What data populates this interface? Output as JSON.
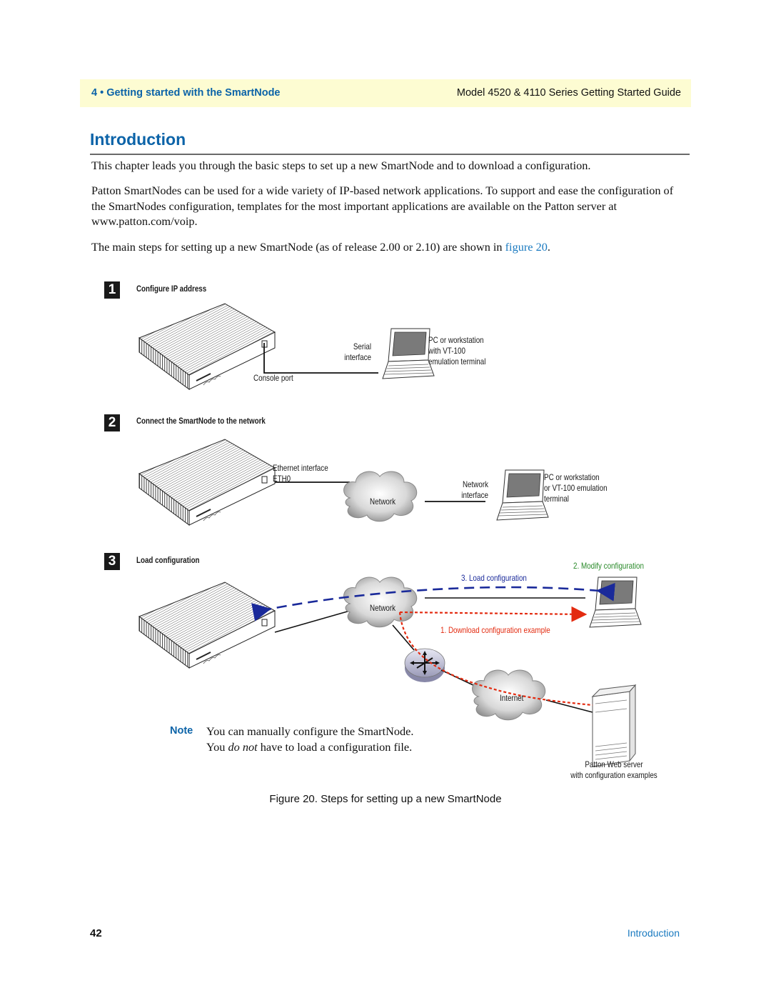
{
  "header": {
    "chapter": "4 • Getting started with the SmartNode",
    "guide_title": "Model 4520 & 4110 Series Getting Started Guide"
  },
  "page_title": "Introduction",
  "paragraphs": {
    "p1": "This chapter leads you through the basic steps to set up a new SmartNode and to download a configuration.",
    "p2": "Patton SmartNodes can be used for a wide variety of IP-based network applications. To support and ease the configuration of the SmartNodes configuration, templates for the most important applications are available on the Patton server at www.patton.com/voip.",
    "p3_prefix": "The main steps for setting up a new SmartNode (as of release 2.00 or 2.10) are shown in ",
    "p3_link": "figure 20",
    "p3_suffix": "."
  },
  "figure": {
    "step1": {
      "number": "1",
      "title": "Configure IP address",
      "console_port": "Console port",
      "serial_interface_line1": "Serial",
      "serial_interface_line2": "interface",
      "pc_line1": "PC or workstation",
      "pc_line2": "with VT-100",
      "pc_line3": "emulation terminal"
    },
    "step2": {
      "number": "2",
      "title": "Connect the SmartNode to the network",
      "ethernet_line1": "Ethernet interface",
      "ethernet_line2": "ETH0",
      "cloud": "Network",
      "network_interface_line1": "Network",
      "network_interface_line2": "interface",
      "pc_line1": "PC or workstation",
      "pc_line2": "or VT-100 emulation",
      "pc_line3": "terminal"
    },
    "step3": {
      "number": "3",
      "title": "Load configuration",
      "modify": "2. Modify configuration",
      "load": "3. Load configuration",
      "download": "1. Download configuration example",
      "cloud_network": "Network",
      "cloud_internet": "Internet",
      "server_line1": "Patton Web server",
      "server_line2": "with configuration examples"
    },
    "colors": {
      "load_arrow": "#1a2a9a",
      "download_arrow": "#e32b10",
      "modify_label": "#2a8a2a"
    }
  },
  "note": {
    "label": "Note",
    "text_before": "You can manually configure the SmartNode. You ",
    "text_emph": "do not",
    "text_after": " have to load a configuration file."
  },
  "caption": "Figure 20. Steps for setting up a new SmartNode",
  "footer": {
    "page_number": "42",
    "section": "Introduction"
  }
}
